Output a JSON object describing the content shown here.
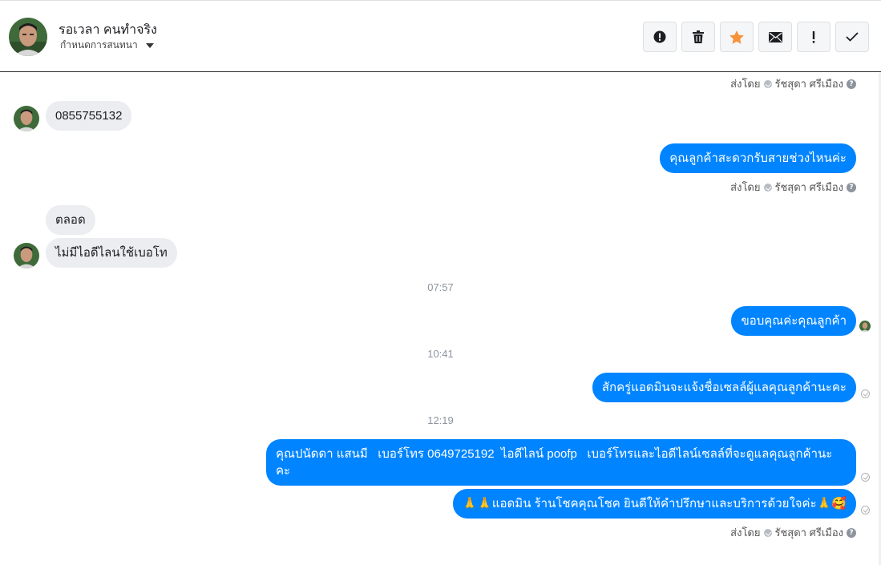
{
  "header": {
    "contact_name": "รอเวลา คนทำจริง",
    "assign_label": "กำหนดการสนทนา",
    "avatar_icon": "person-avatar"
  },
  "toolbar": {
    "buttons": [
      {
        "name": "mark-spam",
        "icon": "alert-circle-icon"
      },
      {
        "name": "delete",
        "icon": "trash-icon"
      },
      {
        "name": "star",
        "icon": "star-icon",
        "color": "#f7923b"
      },
      {
        "name": "mark-unread",
        "icon": "envelope-icon"
      },
      {
        "name": "follow-up",
        "icon": "exclamation-icon"
      },
      {
        "name": "mark-done",
        "icon": "check-icon"
      }
    ]
  },
  "sent_by": {
    "prefix": "ส่งโดย",
    "agent": "รัชสุดา ศรีเมือง"
  },
  "messages": {
    "m1": "0855755132",
    "m2": "คุณลูกค้าสะดวกรับสายช่วงไหนค่ะ",
    "m3": "ตลอด",
    "m4": "ไม่มีไอดีไลนใช้เบอโท",
    "t1": "07:57",
    "m5": "ขอบคุณค่ะคุณลูกค้า",
    "t2": "10:41",
    "m6": "สักครู่แอดมินจะแจ้งชื่อเซลล์ผู้แลคุณลูกค้านะคะ",
    "t3": "12:19",
    "m7_line1": "คุณปนัดดา แสนมี   เบอร์โทร 0649725192  ไอดีไลน์ poofp   เบอร์โทรและไอดีไลน์เซลล์ที่จะดูแลคุณลูกค้านะ",
    "m7_line2": "คะ",
    "m8": "🙏🙏แอดมิน ร้านโชคคุณโชค ยินดีให้คำปรึกษาและบริการด้วยใจค่ะ🙏🥰"
  },
  "colors": {
    "outgoing": "#0084ff",
    "incoming": "#ebedf0",
    "star": "#f7923b"
  }
}
